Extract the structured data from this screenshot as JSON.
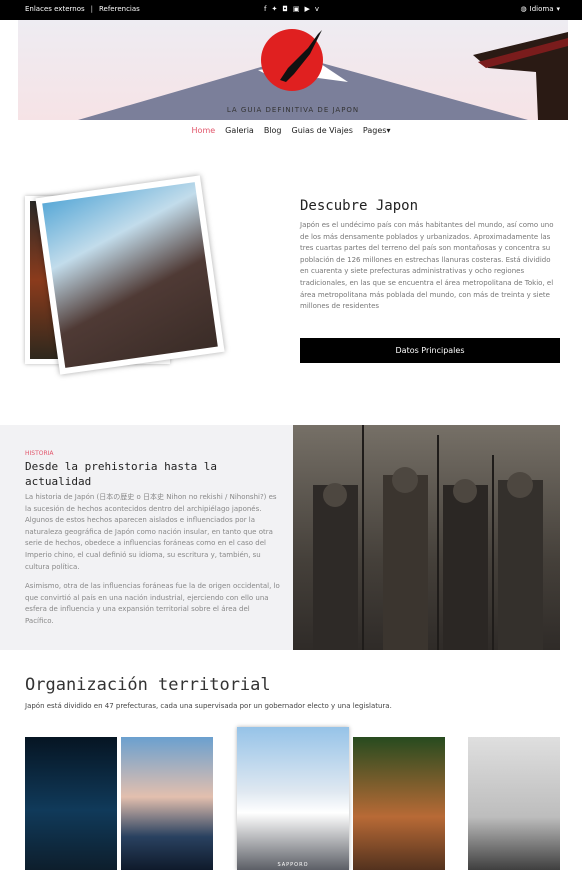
{
  "topbar": {
    "link_external": "Enlaces externos",
    "separator": "|",
    "link_refs": "Referencias",
    "social_icons": [
      "facebook-icon",
      "twitter-icon",
      "instagram-icon",
      "linkedin-icon",
      "youtube-icon",
      "vimeo-icon"
    ],
    "language_label": "Idioma"
  },
  "hero": {
    "tagline": "LA GUIA DEFINITIVA DE JAPON",
    "accent_red": "#e02020"
  },
  "nav": {
    "items": [
      "Home",
      "Galeria",
      "Blog",
      "Guias de Viajes",
      "Pages"
    ],
    "active_color": "#e2566b"
  },
  "descubre": {
    "title": "Descubre Japon",
    "text": "Japón es el undécimo país con más habitantes del mundo, así como uno de los más densamente poblados y urbanizados. Aproximadamente las tres cuartas partes del terreno del país son montañosas y concentra su población de 126 millones en estrechas llanuras costeras. Está dividido en cuarenta y siete prefecturas administrativas y ocho regiones tradicionales, en las que se encuentra el área metropolitana de Tokio, el área metropolitana más poblada del mundo, con más de treinta y siete millones de residentes",
    "button": "Datos Principales"
  },
  "historia": {
    "kicker": "HISTORIA",
    "title": "Desde la prehistoria hasta la actualidad",
    "p1": "La historia de Japón (日本の歴史 o 日本史 Nihon no rekishi / Nihonshi?) es la sucesión de hechos acontecidos dentro del archipiélago japonés. Algunos de estos hechos aparecen aislados e influenciados por la naturaleza geográfica de Japón como nación insular, en tanto que otra serie de hechos, obedece a influencias foráneas como en el caso del Imperio chino, el cual definió su idioma, su escritura y, también, su cultura política.",
    "p2": "Asimismo, otra de las influencias foráneas fue la de origen occidental, lo que convirtió al país en una nación industrial, ejerciendo con ello una esfera de influencia y una expansión territorial sobre el área del Pacífico."
  },
  "organizacion": {
    "title": "Organización territorial",
    "subtitle": "Japón está dividido en 47 prefecturas, cada una supervisada por un gobernador electo y una legislatura.",
    "gallery_caption": "SAPPORO"
  }
}
